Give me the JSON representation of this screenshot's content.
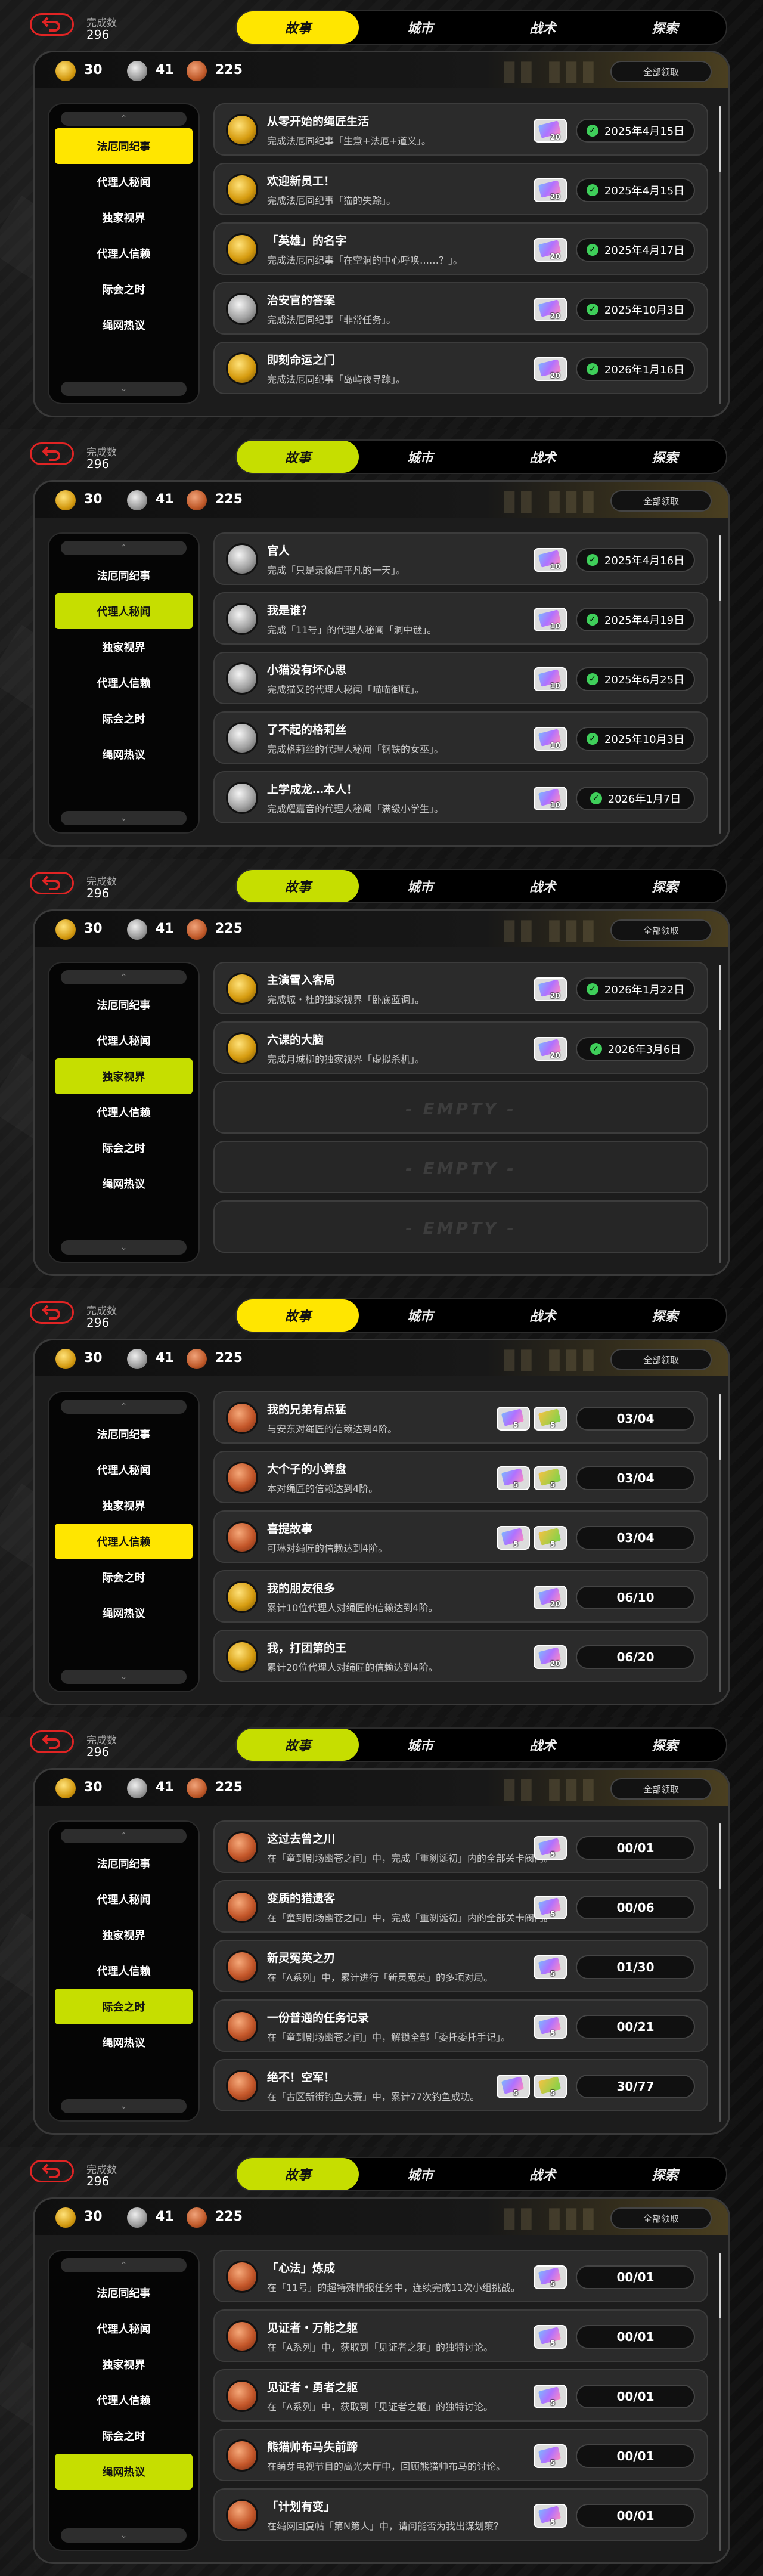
{
  "header": {
    "label": "完成数",
    "value": "296"
  },
  "tabs": [
    "故事",
    "城市",
    "战术",
    "探索"
  ],
  "counts": {
    "gold": "30",
    "silver": "41",
    "bronze": "225"
  },
  "claim_all": "全部领取",
  "categories": [
    "法厄同纪事",
    "代理人秘闻",
    "独家视界",
    "代理人信赖",
    "际会之时",
    "绳网热议"
  ],
  "empty_label": "- EMPTY -",
  "colors": {
    "yellow": "#ffe600",
    "lime": "#c6de00",
    "check": "#3fcf5a",
    "back": "#e02424"
  },
  "panels": [
    {
      "accent": "yellow",
      "active_category": 0,
      "rows": [
        {
          "medal": "gold",
          "title": "从零开始的绳匠生活",
          "desc": "完成法厄同纪事「生意+法厄+道义」。",
          "reward": "20",
          "date": "2025年4月15日"
        },
        {
          "medal": "gold",
          "title": "欢迎新员工！",
          "desc": "完成法厄同纪事「猫的失踪」。",
          "reward": "20",
          "date": "2025年4月15日"
        },
        {
          "medal": "gold",
          "title": "「英雄」的名字",
          "desc": "完成法厄同纪事「在空洞的中心呼唤……？」。",
          "reward": "20",
          "date": "2025年4月17日"
        },
        {
          "medal": "silver",
          "title": "治安官的答案",
          "desc": "完成法厄同纪事「非常任务」。",
          "reward": "20",
          "date": "2025年10月3日"
        },
        {
          "medal": "gold",
          "title": "即刻命运之门",
          "desc": "完成法厄同纪事「岛屿夜寻踪」。",
          "reward": "20",
          "date": "2026年1月16日"
        }
      ]
    },
    {
      "accent": "lime",
      "active_category": 1,
      "rows": [
        {
          "medal": "silver",
          "title": "官人",
          "desc": "完成「只是录像店平凡的一天」。",
          "reward": "10",
          "date": "2025年4月16日"
        },
        {
          "medal": "silver",
          "title": "我是谁？",
          "desc": "完成「11号」的代理人秘闻「洞中谜」。",
          "reward": "10",
          "date": "2025年4月19日"
        },
        {
          "medal": "silver",
          "title": "小猫没有坏心思",
          "desc": "完成猫又的代理人秘闻「喵喵御赋」。",
          "reward": "10",
          "date": "2025年6月25日"
        },
        {
          "medal": "silver",
          "title": "了不起的格莉丝",
          "desc": "完成格莉丝的代理人秘闻「钢铁的女巫」。",
          "reward": "10",
          "date": "2025年10月3日"
        },
        {
          "medal": "silver",
          "title": "上学成龙…本人！",
          "desc": "完成耀嘉音的代理人秘闻「满级小学生」。",
          "reward": "10",
          "date": "2026年1月7日"
        }
      ]
    },
    {
      "accent": "lime",
      "active_category": 2,
      "rows": [
        {
          "medal": "gold",
          "title": "主演雪入客局",
          "desc": "完成城・杜的独家视界「卧底蓝调」。",
          "reward": "20",
          "date": "2026年1月22日"
        },
        {
          "medal": "gold",
          "title": "六课的大脑",
          "desc": "完成月城柳的独家视界「虚拟杀机」。",
          "reward": "20",
          "date": "2026年3月6日"
        }
      ]
    },
    {
      "accent": "yellow",
      "active_category": 3,
      "rows": [
        {
          "medal": "bronze",
          "title": "我的兄弟有点猛",
          "desc": "与安东对绳匠的信赖达到4阶。",
          "rewards": [
            "5",
            "5"
          ],
          "progress": "03/04"
        },
        {
          "medal": "bronze",
          "title": "大个子的小算盘",
          "desc": "本对绳匠的信赖达到4阶。",
          "rewards": [
            "5",
            "5"
          ],
          "progress": "03/04"
        },
        {
          "medal": "bronze",
          "title": "喜提故事",
          "desc": "可琳对绳匠的信赖达到4阶。",
          "rewards": [
            "5",
            "5"
          ],
          "progress": "03/04"
        },
        {
          "medal": "gold",
          "title": "我的朋友很多",
          "desc": "累计10位代理人对绳匠的信赖达到4阶。",
          "rewards": [
            "20"
          ],
          "progress": "06/10"
        },
        {
          "medal": "gold",
          "title": "我，打团第的王",
          "desc": "累计20位代理人对绳匠的信赖达到4阶。",
          "rewards": [
            "20"
          ],
          "progress": "06/20"
        }
      ]
    },
    {
      "accent": "lime",
      "active_category": 4,
      "rows": [
        {
          "medal": "bronze",
          "title": "这过去曾之川",
          "desc": "在「童到剧场幽苍之间」中，完成「重刹诞初」内的全部关卡阀门。",
          "reward": "5",
          "progress": "00/01"
        },
        {
          "medal": "bronze",
          "title": "变质的猎遗客",
          "desc": "在「童到剧场幽苍之间」中，完成「重刹诞初」内的全部关卡阀门。",
          "reward": "5",
          "progress": "00/06"
        },
        {
          "medal": "bronze",
          "title": "新灵冤英之刃",
          "desc": "在「A系列」中，累计进行「新灵冤英」的多项对局。",
          "reward": "5",
          "progress": "01/30"
        },
        {
          "medal": "bronze",
          "title": "一份普通的任务记录",
          "desc": "在「童到剧场幽苍之间」中，解锁全部「委托委托手记」。",
          "reward": "5",
          "progress": "00/21"
        },
        {
          "medal": "bronze",
          "title": "绝不！空军！",
          "desc": "在「古区新街钓鱼大赛」中，累计77次钓鱼成功。",
          "rewards": [
            "5",
            "5"
          ],
          "progress": "30/77"
        }
      ]
    },
    {
      "accent": "lime",
      "active_category": 5,
      "rows": [
        {
          "medal": "bronze",
          "title": "「心法」炼成",
          "desc": "在「11号」的超特殊情报任务中，连续完成11次小组挑战。",
          "reward": "5",
          "progress": "00/01"
        },
        {
          "medal": "bronze",
          "title": "见证者・万能之躯",
          "desc": "在「A系列」中，获取到「见证者之躯」的独特讨论。",
          "reward": "5",
          "progress": "00/01"
        },
        {
          "medal": "bronze",
          "title": "见证者・勇者之躯",
          "desc": "在「A系列」中，获取到「见证者之躯」的独特讨论。",
          "reward": "5",
          "progress": "00/01"
        },
        {
          "medal": "bronze",
          "title": "熊猫帅布马失前蹄",
          "desc": "在萌芽电视节目的高光大厅中，回顾熊猫帅布马的讨论。",
          "reward": "5",
          "progress": "00/01"
        },
        {
          "medal": "bronze",
          "title": "「计划有变」",
          "desc": "在绳网回复帖「第N第人」中，请问能否为我出谋划策？",
          "reward": "5",
          "progress": "00/01"
        }
      ]
    }
  ]
}
